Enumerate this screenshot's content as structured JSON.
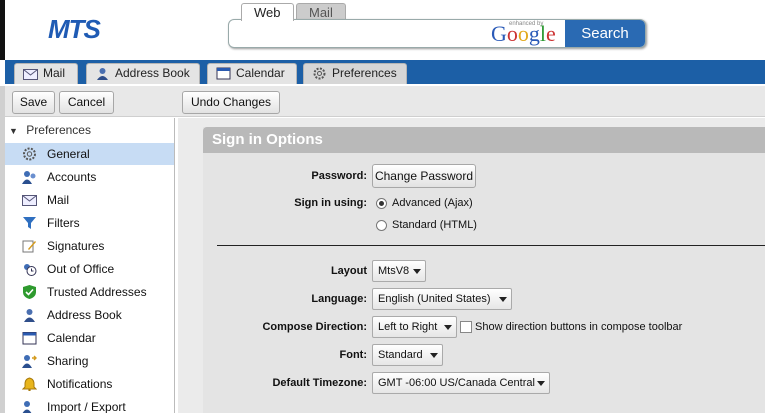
{
  "header": {
    "logo": "MTS",
    "search_tabs": [
      "Web",
      "Mail"
    ],
    "search_input_value": "",
    "google_small": "enhanced by",
    "google_logo": "Google",
    "search_button": "Search"
  },
  "nav_tabs": [
    {
      "label": "Mail",
      "icon": "mail-icon"
    },
    {
      "label": "Address Book",
      "icon": "contacts-icon"
    },
    {
      "label": "Calendar",
      "icon": "calendar-icon"
    },
    {
      "label": "Preferences",
      "icon": "gear-icon",
      "active": true
    }
  ],
  "toolbar": {
    "save_label": "Save",
    "cancel_label": "Cancel",
    "undo_label": "Undo Changes"
  },
  "sidebar": {
    "header": "Preferences",
    "items": [
      {
        "label": "General",
        "icon": "gear-icon",
        "selected": true
      },
      {
        "label": "Accounts",
        "icon": "accounts-icon"
      },
      {
        "label": "Mail",
        "icon": "mail-icon"
      },
      {
        "label": "Filters",
        "icon": "filter-icon"
      },
      {
        "label": "Signatures",
        "icon": "signature-icon"
      },
      {
        "label": "Out of Office",
        "icon": "clock-icon"
      },
      {
        "label": "Trusted Addresses",
        "icon": "shield-icon"
      },
      {
        "label": "Address Book",
        "icon": "contacts-icon"
      },
      {
        "label": "Calendar",
        "icon": "calendar-icon"
      },
      {
        "label": "Sharing",
        "icon": "sharing-icon"
      },
      {
        "label": "Notifications",
        "icon": "bell-icon"
      },
      {
        "label": "Import / Export",
        "icon": "import-export-icon"
      }
    ]
  },
  "section": {
    "title": "Sign in Options",
    "password_label": "Password:",
    "change_password_button": "Change Password",
    "sign_in_label": "Sign in using:",
    "sign_in_options": [
      "Advanced (Ajax)",
      "Standard (HTML)"
    ],
    "sign_in_selected": "Advanced (Ajax)",
    "layout_label": "Layout",
    "layout_value": "MtsV8",
    "language_label": "Language:",
    "language_value": "English (United States)",
    "compose_direction_label": "Compose Direction:",
    "compose_direction_value": "Left to Right",
    "show_direction_label": "Show direction buttons in compose toolbar",
    "show_direction_checked": false,
    "font_label": "Font:",
    "font_value": "Standard",
    "timezone_label": "Default Timezone:",
    "timezone_value": "GMT -06:00 US/Canada Central"
  },
  "colors": {
    "brand_blue": "#1c5fa6",
    "search_button": "#2a6ab3",
    "selected_item": "#c7dcf4",
    "panel_title": "#b9b9b9"
  }
}
